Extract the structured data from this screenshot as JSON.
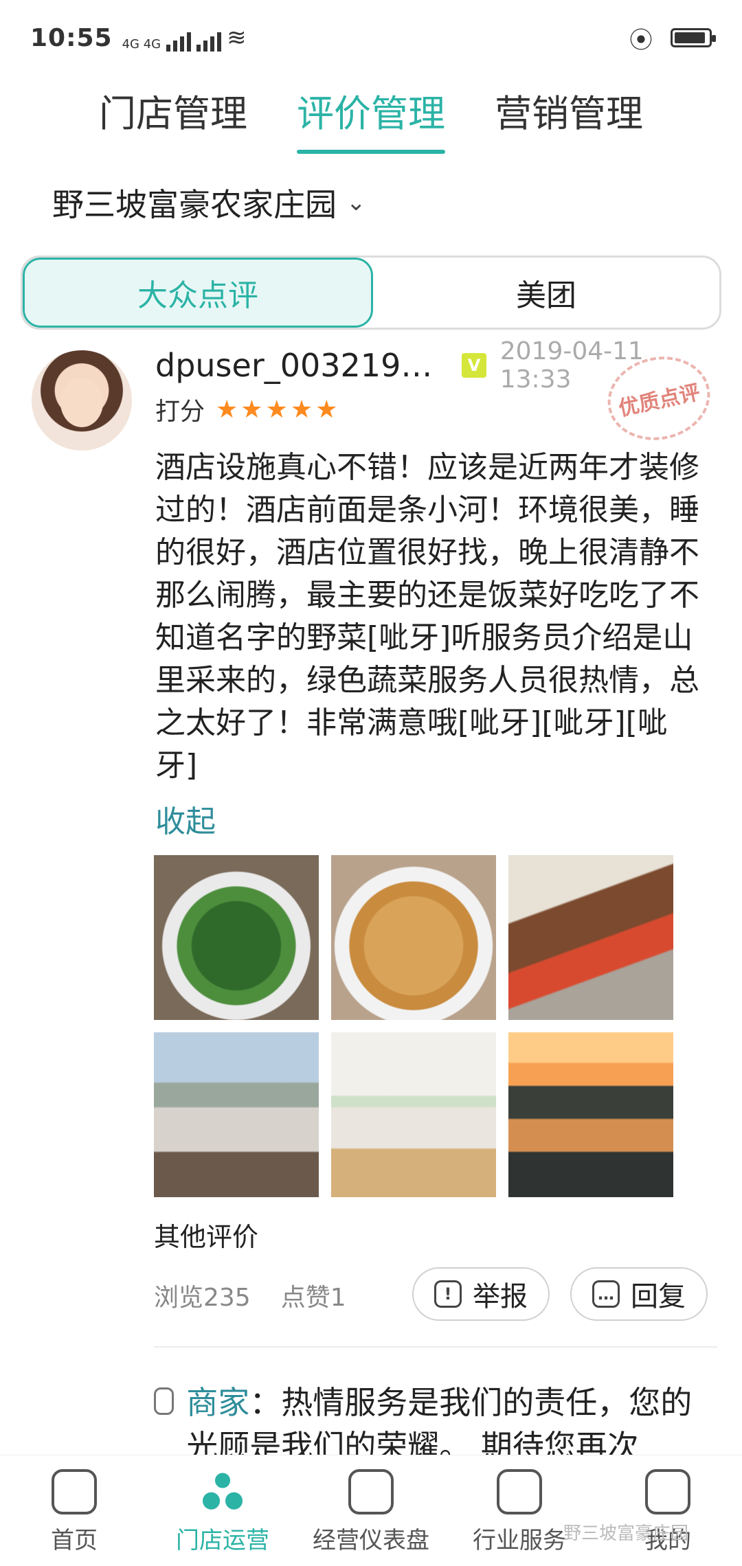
{
  "status": {
    "time": "10:55",
    "network": "4G 4G"
  },
  "topnav": {
    "tabs": [
      {
        "label": "门店管理"
      },
      {
        "label": "评价管理"
      },
      {
        "label": "营销管理"
      }
    ]
  },
  "store": {
    "name": "野三坡富豪农家庄园",
    "chevron": "⌄"
  },
  "segment": {
    "options": [
      {
        "label": "大众点评"
      },
      {
        "label": "美团"
      }
    ]
  },
  "review": {
    "username": "dpuser_0032192…",
    "badge": "V",
    "date": "2019-04-11 13:33",
    "rating_label": "打分",
    "stars": 5,
    "stamp": "优质点评",
    "text": "酒店设施真心不错！应该是近两年才装修过的！酒店前面是条小河！环境很美，睡的很好，酒店位置很好找，晚上很清静不那么闹腾，最主要的还是饭菜好吃吃了不知道名字的野菜[呲牙]听服务员介绍是山里采来的，绿色蔬菜服务人员很热情，总之太好了！非常满意哦[呲牙][呲牙][呲牙]",
    "collapse": "收起"
  },
  "other_reviews": "其他评价",
  "metrics": {
    "views": "浏览235",
    "likes": "点赞1"
  },
  "actions": {
    "report": "举报",
    "reply": "回复"
  },
  "merchant": {
    "label": "商家",
    "text": "热情服务是我们的责任，您的光顾是我们的荣耀。 期待您再次"
  },
  "bottom_nav": {
    "items": [
      {
        "label": "首页"
      },
      {
        "label": "门店运营"
      },
      {
        "label": "经营仪表盘"
      },
      {
        "label": "行业服务"
      },
      {
        "label": "我的"
      }
    ]
  },
  "watermark": "野三坡富豪庄园"
}
